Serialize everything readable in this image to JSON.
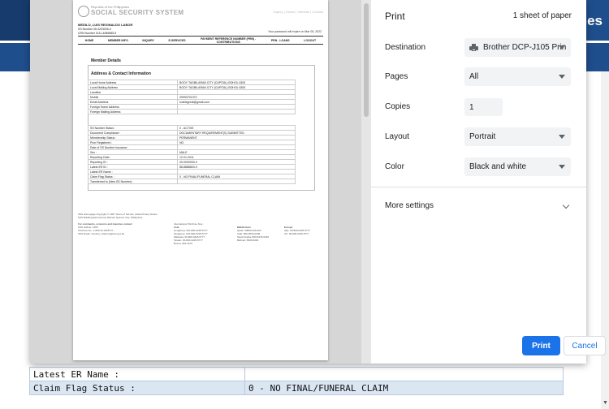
{
  "background": {
    "header_title": "ones",
    "table_rows": [
      {
        "label": "Latest ER Name :",
        "value": ""
      },
      {
        "label": "Claim Flag Status :",
        "value": "0 - NO FINAL/FUNERAL CLAIM"
      }
    ]
  },
  "preview": {
    "org_small": "Republic of the Philippines",
    "org_name": "SOCIAL SECURITY SYSTEM",
    "top_links": "Inquiry | Online | Website | Contact",
    "user_name": "MEDILO, LUIS REGINALDO LABOR",
    "ss_number": "SS Number 06-3203026-3",
    "crn_number": "CRN Number 0111-4086885-5",
    "expire_notice": "Your password will expire on Mar 05, 2022",
    "menu": [
      "HOME",
      "MEMBER INFO",
      "INQUIRY",
      "E-SERVICES",
      "PAYMENT REFERENCE NUMBER (PRN) - CONTRIBUTIONS",
      "PRN - LOANS",
      "LOGOUT"
    ],
    "section_title": "Member Details",
    "sub_title": "Address & Contact Information",
    "contact_rows": [
      {
        "k": "Local Home Address",
        "v": "BOOY TAGBILARAN CITY (CAPITAL) BOHOL 6300"
      },
      {
        "k": "Local Mailing Address",
        "v": "BOOY TAGBILARAN CITY (CAPITAL) BOHOL 6300"
      },
      {
        "k": "Landline",
        "v": ""
      },
      {
        "k": "Mobile",
        "v": "09993791373"
      },
      {
        "k": "Email Address",
        "v": "louthegreat@gmail.com"
      },
      {
        "k": "Foreign Home Address",
        "v": ""
      },
      {
        "k": "Foreign Mailing Address",
        "v": ""
      }
    ],
    "status_rows": [
      {
        "k": "SS Number Status :",
        "v": "0 - ACTIVE"
      },
      {
        "k": "Document Compliance :",
        "v": "DOCUMENTARY REQUIREMENT(S) SUBMITTED"
      },
      {
        "k": "Membership Status :",
        "v": "PERMANENT"
      },
      {
        "k": "Prior Registered :",
        "v": "NO"
      },
      {
        "k": "Date of SS Number Issuance :",
        "v": ""
      },
      {
        "k": "Sex :",
        "v": "MALE"
      },
      {
        "k": "Reporting Date :",
        "v": "12-01-2011"
      },
      {
        "k": "Reporting ID :",
        "v": "00-0000000-0"
      },
      {
        "k": "Latest ER ID :",
        "v": "88-8888800-9"
      },
      {
        "k": "Latest ER Name :",
        "v": ""
      },
      {
        "k": "Claim Flag Status :",
        "v": "0 - NO FINAL/FUNERAL CLAIM"
      },
      {
        "k": "Transferred to (New SS Number) :",
        "v": ""
      }
    ],
    "footer_line1": "SSS Homepage Copyright © 1997 Terms of Service | Data Privacy Notice",
    "footer_line2": "SSS Building East Avenue Diliman Quezon City, Philippines",
    "footer_contact_title": "For comments, concerns and inquiries contact",
    "footer_contact_lines": [
      "SSS Hotline: 1455",
      "Toll-Free No.: 1-800-10-2255777",
      "SSS Email: member_relations@sss.gov.ph"
    ],
    "footer_intl_title": "International Toll-Free Nos.:",
    "footer_cols": [
      {
        "title": "Asia",
        "lines": [
          "Hongkong: 001-800-0225-5777",
          "Singapore: 001-800-0225-5777",
          "Malaysia: 00-800-0225-5777",
          "Taiwan: 00-800-0225-5777",
          "Brunei: 801-4275"
        ]
      },
      {
        "title": "Middle East",
        "lines": [
          "Qatar: 00800-100-260",
          "UAE: 800-0630-0038",
          "Saudi Arabia: 800-8445-6362",
          "Bahrain: 8000-6094"
        ]
      },
      {
        "title": "Europe",
        "lines": [
          "Italy: 00-800-0225-5777",
          "UK: 00-800-0225-5777"
        ]
      }
    ]
  },
  "print_dialog": {
    "title": "Print",
    "sheets": "1 sheet of paper",
    "destination_label": "Destination",
    "destination_value": "Brother DCP-J105 Prin",
    "pages_label": "Pages",
    "pages_value": "All",
    "copies_label": "Copies",
    "copies_value": "1",
    "layout_label": "Layout",
    "layout_value": "Portrait",
    "color_label": "Color",
    "color_value": "Black and white",
    "more_settings_label": "More settings",
    "print_button": "Print",
    "cancel_button": "Cancel",
    "accent_color": "#1a73e8"
  }
}
